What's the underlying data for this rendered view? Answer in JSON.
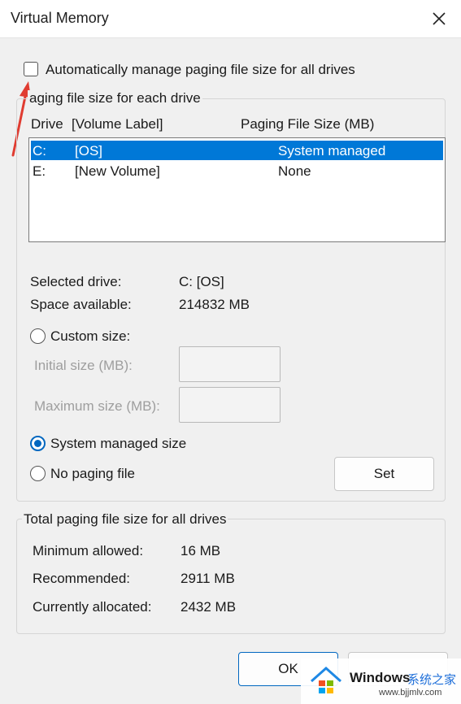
{
  "window": {
    "title": "Virtual Memory"
  },
  "auto_manage": {
    "label": "Automatically manage paging file size for all drives",
    "checked": false
  },
  "paging_group": {
    "title": "aging file size for each drive",
    "headers": {
      "drive": "Drive",
      "volume": "[Volume Label]",
      "size": "Paging File Size (MB)"
    },
    "drives": [
      {
        "drive": "C:",
        "volume": "[OS]",
        "size": "System managed",
        "selected": true
      },
      {
        "drive": "E:",
        "volume": "[New Volume]",
        "size": "None",
        "selected": false
      }
    ],
    "selected_drive_label": "Selected drive:",
    "selected_drive_value": "C:  [OS]",
    "space_label": "Space available:",
    "space_value": "214832 MB",
    "custom_size_label": "Custom size:",
    "initial_label": "Initial size (MB):",
    "initial_value": "",
    "maximum_label": "Maximum size (MB):",
    "maximum_value": "",
    "system_managed_label": "System managed size",
    "no_paging_label": "No paging file",
    "selected_option": "system_managed",
    "set_label": "Set"
  },
  "total_group": {
    "title": "Total paging file size for all drives",
    "min_label": "Minimum allowed:",
    "min_value": "16 MB",
    "rec_label": "Recommended:",
    "rec_value": "2911 MB",
    "cur_label": "Currently allocated:",
    "cur_value": "2432 MB"
  },
  "buttons": {
    "ok": "OK"
  },
  "watermark": {
    "brand": "Windows",
    "site_cn": "系统之家",
    "url": "www.bjjmlv.com"
  },
  "colors": {
    "selection": "#0078d7",
    "accent": "#0067c0",
    "arrow": "#e03c31"
  }
}
